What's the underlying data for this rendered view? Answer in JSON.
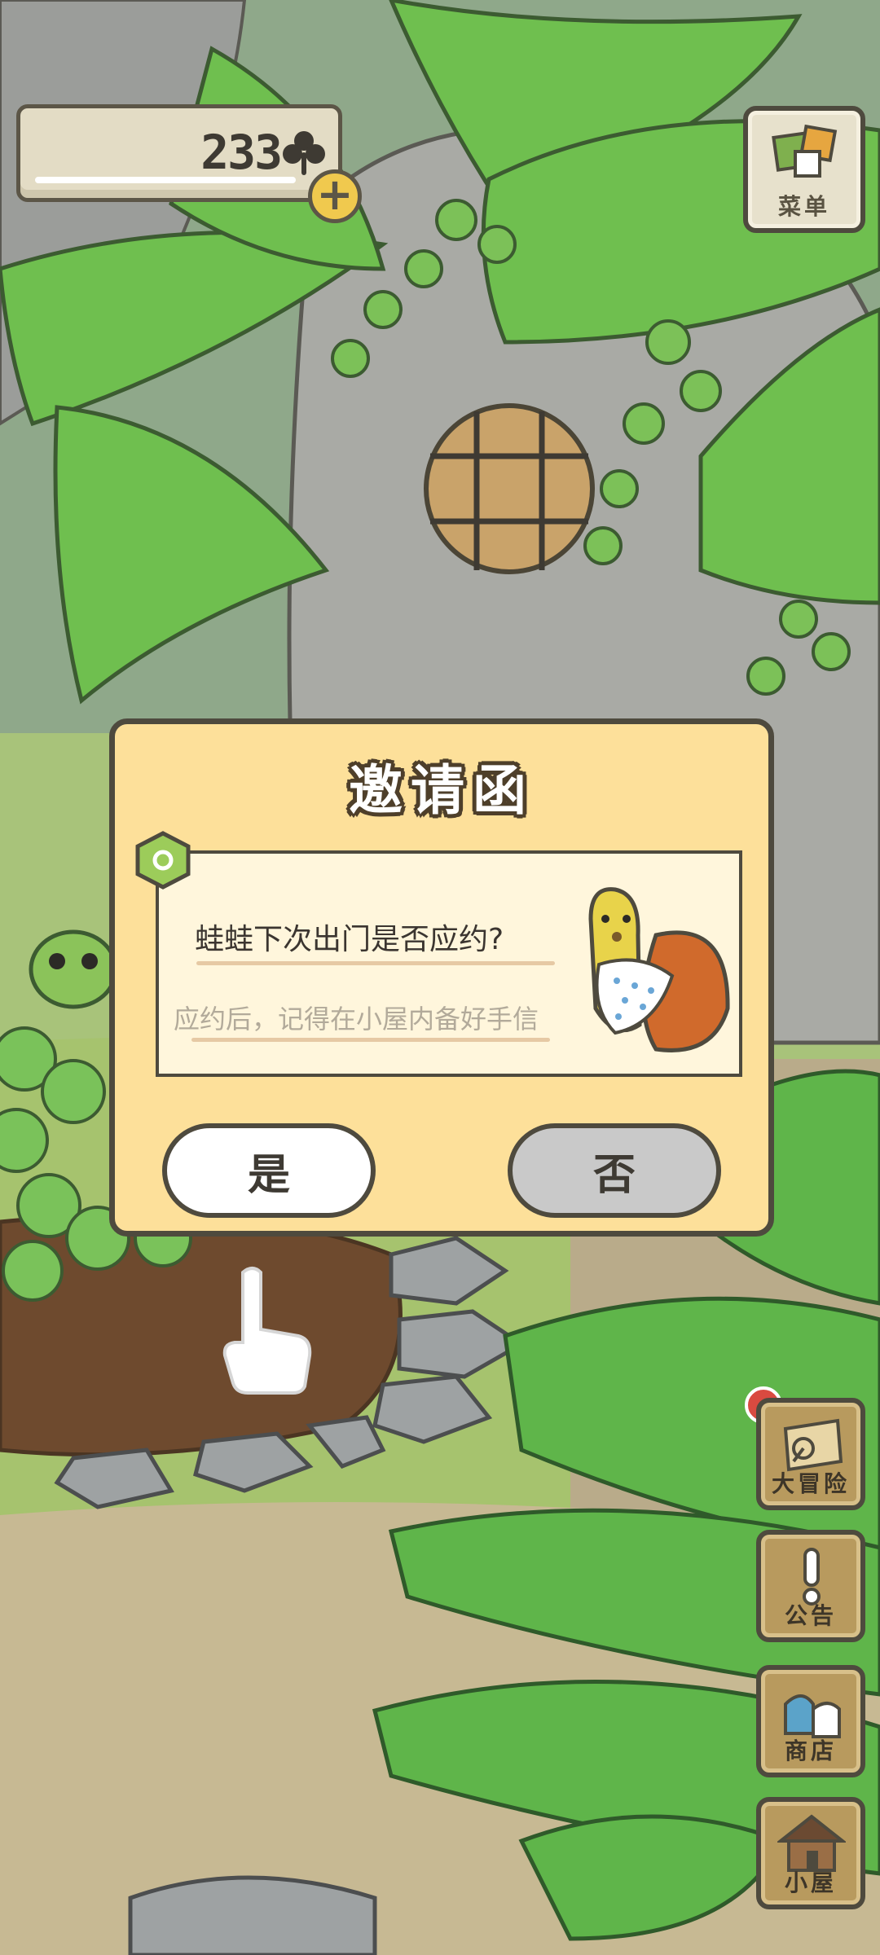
{
  "currency": {
    "amount": "233",
    "icon": "clover-icon",
    "add_icon": "plus-icon"
  },
  "menu": {
    "label": "菜单"
  },
  "dialog": {
    "title": "邀请函",
    "question": "蛙蛙下次出门是否应约?",
    "hint": "应约后，记得在小屋内备好手信",
    "yes_label": "是",
    "no_label": "否"
  },
  "side_buttons": [
    {
      "label": "大冒险",
      "icon": "adventure-map-icon",
      "has_notification": true
    },
    {
      "label": "公告",
      "icon": "exclamation-icon"
    },
    {
      "label": "商店",
      "icon": "shop-bags-icon"
    },
    {
      "label": "小屋",
      "icon": "house-icon"
    }
  ],
  "colors": {
    "dialog_bg": "#fde09a",
    "outline": "#4e4a3e",
    "notification": "#d94a40"
  }
}
